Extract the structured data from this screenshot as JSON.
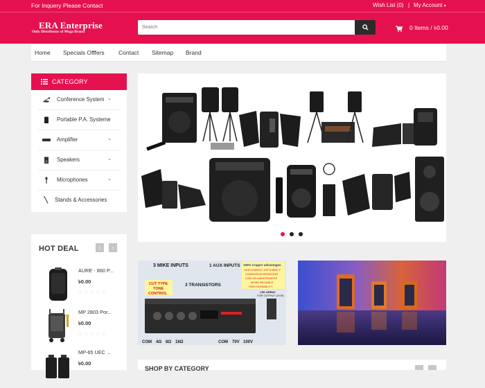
{
  "topbar": {
    "inquiry": "For Inquery Please Contact",
    "wishlist": "Wish List (0)",
    "separator": "|",
    "account": "My Account",
    "brand_color": "#e5114f"
  },
  "logo": {
    "title": "ERA Enterprise",
    "subtitle": "Only Distributor of Mega Brand"
  },
  "search": {
    "placeholder": "Search"
  },
  "cart": {
    "label": "0 Items / ৳0.00"
  },
  "nav": {
    "items": [
      "Home",
      "Specials Offfers",
      "Contact",
      "Sitemap",
      "Brand"
    ]
  },
  "category": {
    "title": "CATEGORY",
    "items": [
      {
        "label": "Conference System",
        "icon": "microphone-gooseneck-icon"
      },
      {
        "label": "Portable P.A. Systems",
        "icon": "portable-speaker-icon"
      },
      {
        "label": "Amplifier",
        "icon": "amplifier-icon"
      },
      {
        "label": "Speakers",
        "icon": "speaker-icon"
      },
      {
        "label": "Microphones",
        "icon": "microphone-icon"
      },
      {
        "label": "Stands & Accessories",
        "icon": "stand-icon"
      }
    ]
  },
  "hot_deal": {
    "title": "HOT DEAL",
    "prev": "‹",
    "next": "›",
    "items": [
      {
        "name": "AURE - 860 P...",
        "price": "৳0.00",
        "stars": "☆☆☆☆☆"
      },
      {
        "name": "MP 2803 Por...",
        "price": "৳0.00",
        "stars": "☆☆☆☆☆"
      },
      {
        "name": "MP-65 UEC ...",
        "price": "৳0.00",
        "stars": ""
      }
    ]
  },
  "slider": {
    "slides": 3,
    "active": 1
  },
  "banner1": {
    "mike": "3 MIKE INPUTS",
    "aux": "1 AUX INPUTS",
    "copper": "100% Copper advantages",
    "efficiency": "HIGH ENERGY EFFICIENCY",
    "corrosion": "CORROSION RESISTANT",
    "maintenance": "LOW ON MAINTENANCE",
    "reliable": "MORE RELIABLE",
    "durability": "HIGH DURABILITY",
    "cut": "CUT TYPE",
    "tone": "TONE",
    "control": "CONTROL",
    "transistors": "3 TRANSISTORS",
    "led": "LED ARRAY",
    "output": "FOR OUTPUT LEVEL",
    "com1": "COM",
    "ohm4": "4Ω",
    "ohm8": "8Ω",
    "ohm16": "16Ω",
    "com2": "COM",
    "v70": "70V",
    "v100": "100V"
  },
  "shop_by_category": {
    "title": "SHOP BY CATEGORY"
  }
}
